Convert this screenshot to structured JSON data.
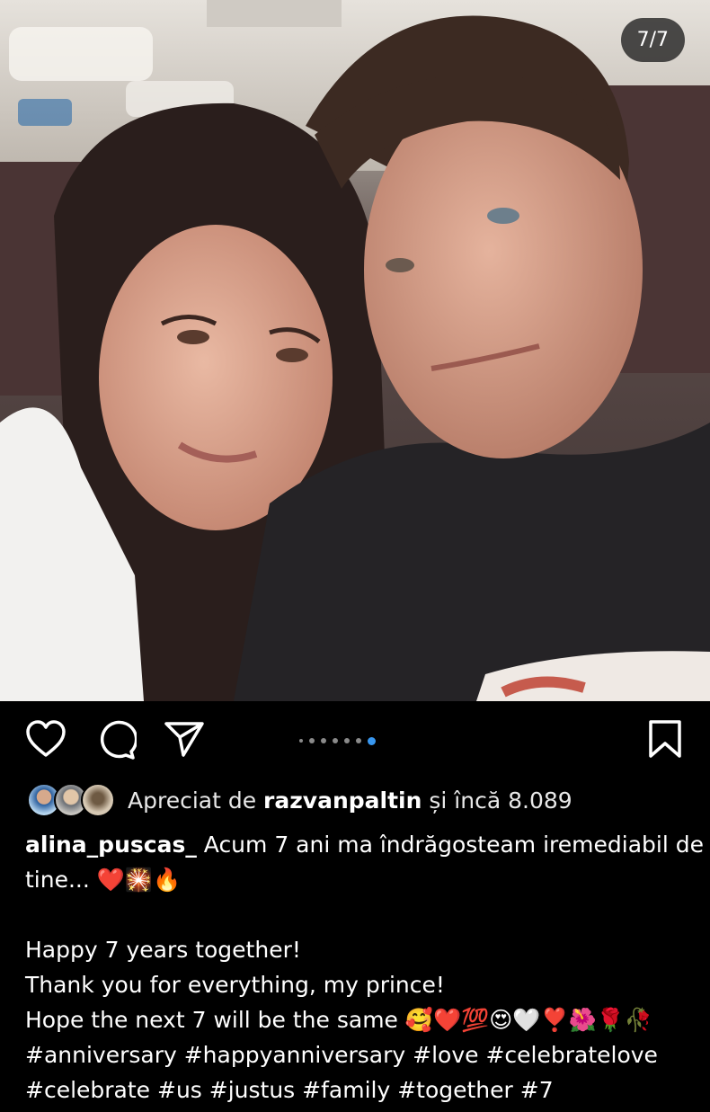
{
  "slide_counter": "7/7",
  "carousel": {
    "total": 7,
    "active_index": 7
  },
  "likes": {
    "prefix": "Apreciat de ",
    "user": "razvanpaltin",
    "suffix": " și încă 8.089"
  },
  "caption": {
    "username": "alina_puscas_",
    "text_line1": " Acum 7 ani ma îndrăgosteam iremediabil de",
    "text_line2": "tine... ",
    "line2_emojis": "❤️🎇🔥",
    "paragraph": [
      "Happy 7 years together!",
      "Thank you for everything, my prince!"
    ],
    "line5_text": "Hope the next 7 will be the same ",
    "line5_emojis": "🥰❤️💯😍🤍❣️🌺🌹🥀",
    "hashtags_line1": "#anniversary #happyanniversary #love #celebratelove",
    "hashtags_line2": "#celebrate #us #justus #family #together #7"
  },
  "icons": [
    "heart-icon",
    "comment-icon",
    "share-icon",
    "bookmark-icon"
  ],
  "colors": {
    "background": "#000000",
    "accent_dot": "#3897f0"
  }
}
